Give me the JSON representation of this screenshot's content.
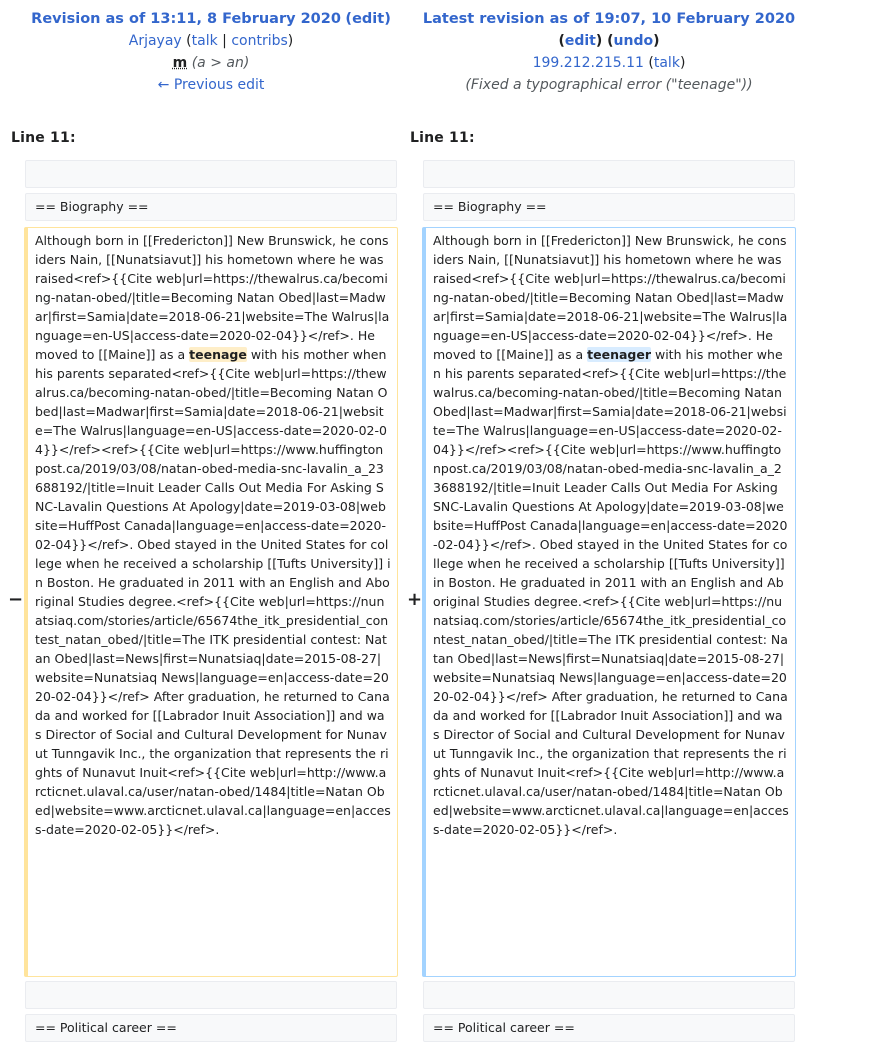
{
  "old_rev": {
    "title": "Revision as of 13:11, 8 February 2020",
    "edit_label": "edit",
    "user": "Arjayay",
    "talk_label": "talk",
    "contribs_label": "contribs",
    "minor_label": "m",
    "summary": "(a > an)",
    "prev_edit_label": "← Previous edit"
  },
  "new_rev": {
    "title": "Latest revision as of 19:07, 10 February 2020",
    "edit_label": "edit",
    "undo_label": "undo",
    "user": "199.212.215.11",
    "talk_label": "talk",
    "summary": "(Fixed a typographical error (\"teenage\"))"
  },
  "diff": {
    "left_line": "Line 11:",
    "right_line": "Line 11:",
    "context_before": "== Biography ==",
    "context_after": "== Political career ==",
    "removed_marker": "−",
    "added_marker": "+",
    "old_text_before": "Although born in [[Fredericton]] New Brunswick, he considers Nain, [[Nunatsiavut]] his hometown where he was raised<ref>{{Cite web|url=https://thewalrus.ca/becoming-natan-obed/|title=Becoming Natan Obed|last=Madwar|first=Samia|date=2018-06-21|website=The Walrus|language=en-US|access-date=2020-02-04}}</ref>. He moved to [[Maine]] as a ",
    "old_changed": "teenage",
    "old_text_after": " with his mother when his parents separated<ref>{{Cite web|url=https://thewalrus.ca/becoming-natan-obed/|title=Becoming Natan Obed|last=Madwar|first=Samia|date=2018-06-21|website=The Walrus|language=en-US|access-date=2020-02-04}}</ref><ref>{{Cite web|url=https://www.huffingtonpost.ca/2019/03/08/natan-obed-media-snc-lavalin_a_23688192/|title=Inuit Leader Calls Out Media For Asking SNC-Lavalin Questions At Apology|date=2019-03-08|website=HuffPost Canada|language=en|access-date=2020-02-04}}</ref>. Obed stayed in the United States for college when he received a scholarship [[Tufts University]] in Boston. He graduated in 2011 with an English and Aboriginal Studies degree.<ref>{{Cite web|url=https://nunatsiaq.com/stories/article/65674the_itk_presidential_contest_natan_obed/|title=The ITK presidential contest: Natan Obed|last=News|first=Nunatsiaq|date=2015-08-27|website=Nunatsiaq News|language=en|access-date=2020-02-04}}</ref> After graduation, he returned to Canada and worked for [[Labrador Inuit Association]] and was Director of Social and Cultural Development for Nunavut Tunngavik Inc., the organization that represents the rights of Nunavut Inuit<ref>{{Cite web|url=http://www.arcticnet.ulaval.ca/user/natan-obed/1484|title=Natan Obed|website=www.arcticnet.ulaval.ca|language=en|access-date=2020-02-05}}</ref>.",
    "new_text_before": "Although born in [[Fredericton]] New Brunswick, he considers Nain, [[Nunatsiavut]] his hometown where he was raised<ref>{{Cite web|url=https://thewalrus.ca/becoming-natan-obed/|title=Becoming Natan Obed|last=Madwar|first=Samia|date=2018-06-21|website=The Walrus|language=en-US|access-date=2020-02-04}}</ref>. He moved to [[Maine]] as a ",
    "new_changed": "teenager",
    "new_text_after": " with his mother when his parents separated<ref>{{Cite web|url=https://thewalrus.ca/becoming-natan-obed/|title=Becoming Natan Obed|last=Madwar|first=Samia|date=2018-06-21|website=The Walrus|language=en-US|access-date=2020-02-04}}</ref><ref>{{Cite web|url=https://www.huffingtonpost.ca/2019/03/08/natan-obed-media-snc-lavalin_a_23688192/|title=Inuit Leader Calls Out Media For Asking SNC-Lavalin Questions At Apology|date=2019-03-08|website=HuffPost Canada|language=en|access-date=2020-02-04}}</ref>. Obed stayed in the United States for college when he received a scholarship [[Tufts University]] in Boston. He graduated in 2011 with an English and Aboriginal Studies degree.<ref>{{Cite web|url=https://nunatsiaq.com/stories/article/65674the_itk_presidential_contest_natan_obed/|title=The ITK presidential contest: Natan Obed|last=News|first=Nunatsiaq|date=2015-08-27|website=Nunatsiaq News|language=en|access-date=2020-02-04}}</ref> After graduation, he returned to Canada and worked for [[Labrador Inuit Association]] and was Director of Social and Cultural Development for Nunavut Tunngavik Inc., the organization that represents the rights of Nunavut Inuit<ref>{{Cite web|url=http://www.arcticnet.ulaval.ca/user/natan-obed/1484|title=Natan Obed|website=www.arcticnet.ulaval.ca|language=en|access-date=2020-02-05}}</ref>."
  },
  "colors": {
    "link": "#3366cc",
    "removed_border": "#ffe49c",
    "added_border": "#a3d3ff",
    "removed_highlight": "#feeec8",
    "added_highlight": "#d8ecff",
    "context_bg": "#f8f9fa"
  }
}
